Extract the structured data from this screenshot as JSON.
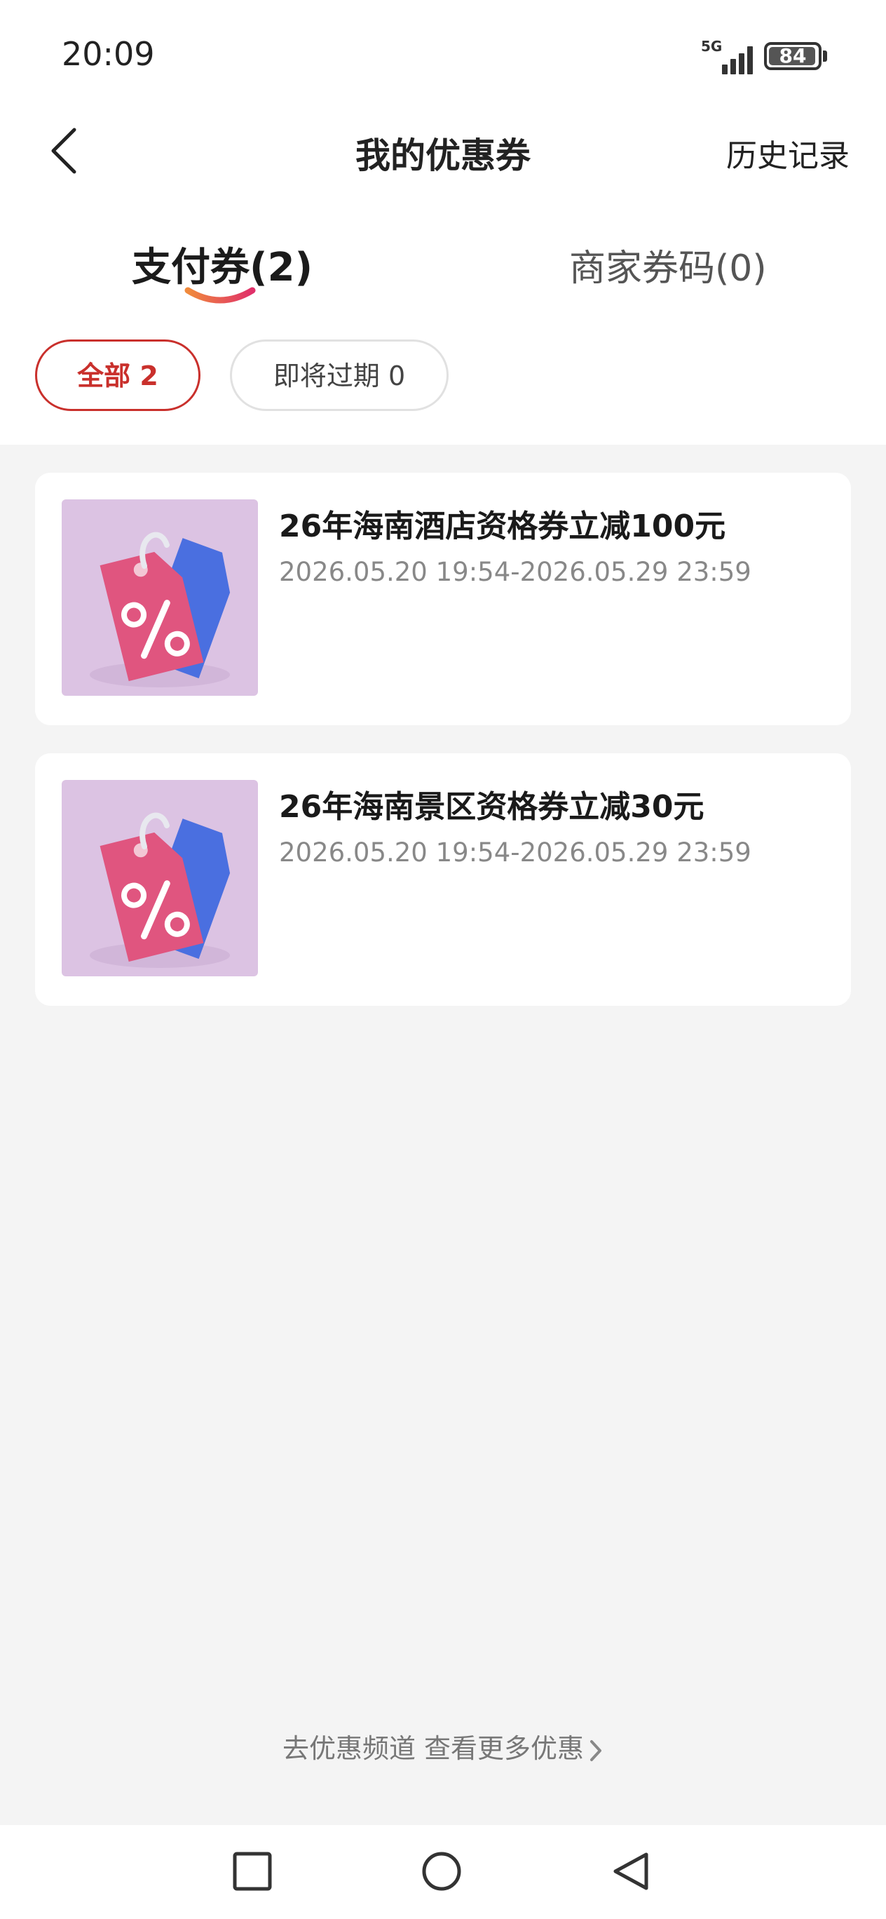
{
  "status_bar": {
    "time": "20:09",
    "network": "5G",
    "battery": "84"
  },
  "header": {
    "title": "我的优惠券",
    "history_label": "历史记录"
  },
  "tabs": [
    {
      "label": "支付券(2)",
      "active": true
    },
    {
      "label": "商家券码(0)",
      "active": false
    }
  ],
  "filters": [
    {
      "label": "全部 2",
      "selected": true
    },
    {
      "label": "即将过期 0",
      "selected": false
    }
  ],
  "coupons": [
    {
      "name": "26年海南酒店资格券立减100元",
      "validity": "2026.05.20 19:54-2026.05.29 23:59",
      "icon": "discount-tag-icon"
    },
    {
      "name": "26年海南景区资格券立减30元",
      "validity": "2026.05.20 19:54-2026.05.29 23:59",
      "icon": "discount-tag-icon"
    }
  ],
  "footer": {
    "more_link": "去优惠频道 查看更多优惠"
  },
  "colors": {
    "accent": "#c9302c",
    "tag_pink": "#e0557f",
    "tag_blue": "#4a6fe0",
    "thumb_bg": "#dcc3e3"
  },
  "nav": {
    "icons": [
      "recent-apps-icon",
      "home-icon",
      "back-nav-icon"
    ]
  }
}
